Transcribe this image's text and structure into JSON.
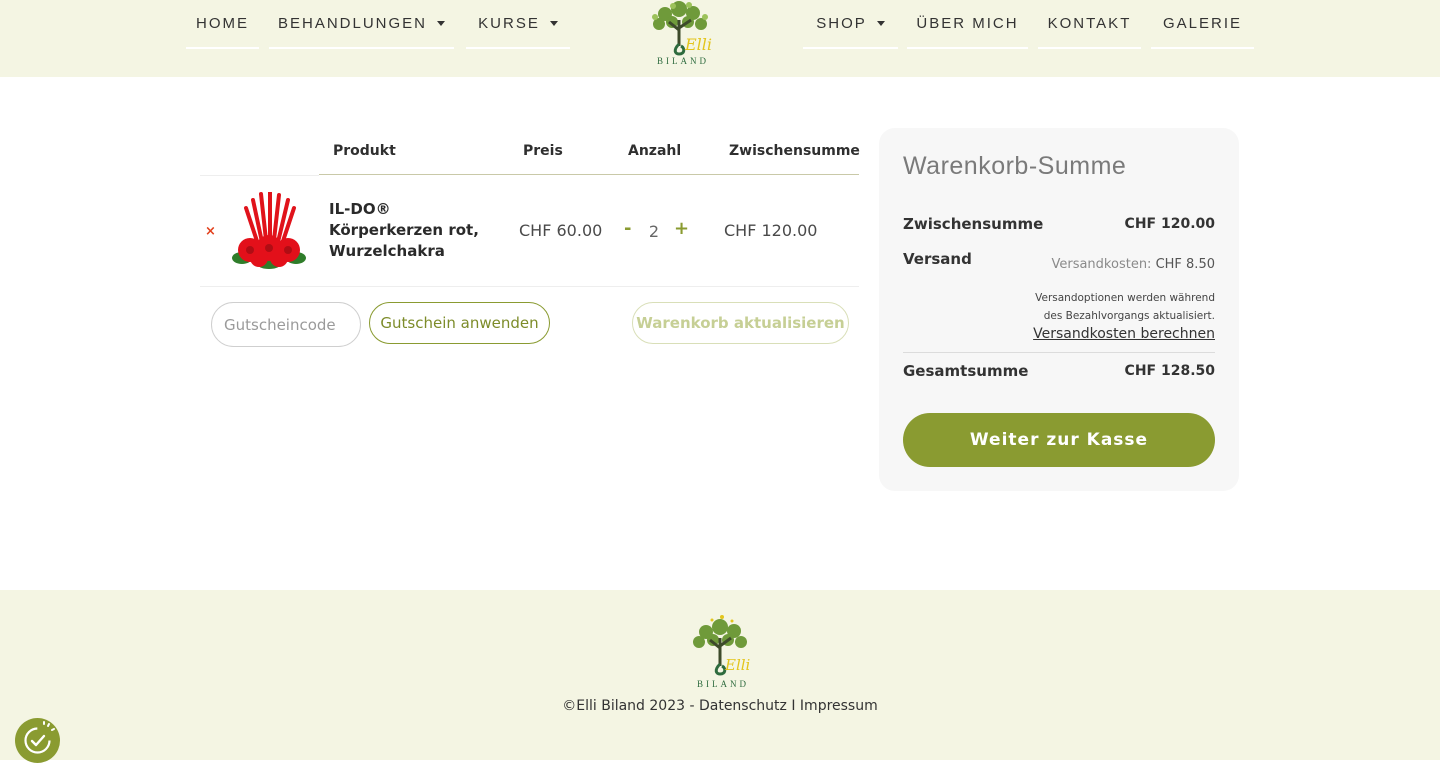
{
  "nav": {
    "left": [
      {
        "label": "HOME"
      },
      {
        "label": "BEHANDLUNGEN"
      },
      {
        "label": "KURSE"
      }
    ],
    "right": [
      {
        "label": "SHOP"
      },
      {
        "label": "ÜBER MICH"
      },
      {
        "label": "KONTAKT"
      },
      {
        "label": "GALERIE"
      }
    ],
    "logo_text": "BILAND",
    "logo_script": "Elli"
  },
  "cart": {
    "headers": {
      "product": "Produkt",
      "price": "Preis",
      "quantity": "Anzahl",
      "subtotal": "Zwischensumme"
    },
    "items": [
      {
        "remove_symbol": "×",
        "name": "IL-DO® Körperkerzen rot, Wurzelchakra",
        "price": "CHF 60.00",
        "quantity": "2",
        "subtotal": "CHF 120.00"
      }
    ],
    "qty_minus": "-",
    "qty_plus": "+",
    "coupon_placeholder": "Gutscheincode",
    "apply_coupon": "Gutschein anwenden",
    "update_cart": "Warenkorb aktualisieren"
  },
  "totals": {
    "title": "Warenkorb-Summe",
    "subtotal_label": "Zwischensumme",
    "subtotal_value": "CHF 120.00",
    "shipping_label": "Versand",
    "shipping_rate_label": "Versandkosten:",
    "shipping_rate_value": "CHF 8.50",
    "shipping_note": "Versandoptionen werden während des Bezahlvorgangs aktualisiert.",
    "shipping_calc": "Versandkosten berechnen",
    "total_label": "Gesamtsumme",
    "total_value": "CHF 128.50",
    "checkout": "Weiter zur Kasse"
  },
  "footer": {
    "copyright": "©Elli Biland 2023 - ",
    "privacy": "Datenschutz",
    "separator": " I ",
    "imprint": "Impressum",
    "logo_text": "BILAND",
    "logo_script": "Elli"
  },
  "colors": {
    "accent": "#8a9b31",
    "header_bg": "#f4f5e3",
    "remove": "#e2401c"
  },
  "icons": {
    "consent": "cookie-consent-icon",
    "caret": "caret-down-icon"
  }
}
